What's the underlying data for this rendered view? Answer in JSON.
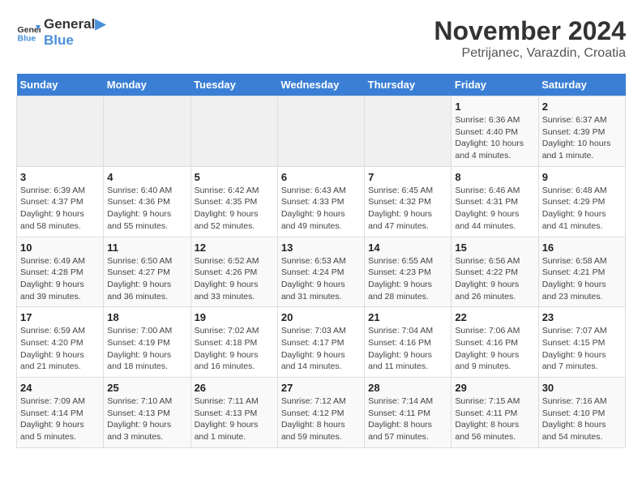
{
  "header": {
    "logo_general": "General",
    "logo_blue": "Blue",
    "month_title": "November 2024",
    "location": "Petrijanec, Varazdin, Croatia"
  },
  "days_of_week": [
    "Sunday",
    "Monday",
    "Tuesday",
    "Wednesday",
    "Thursday",
    "Friday",
    "Saturday"
  ],
  "weeks": [
    [
      {
        "day": "",
        "info": ""
      },
      {
        "day": "",
        "info": ""
      },
      {
        "day": "",
        "info": ""
      },
      {
        "day": "",
        "info": ""
      },
      {
        "day": "",
        "info": ""
      },
      {
        "day": "1",
        "info": "Sunrise: 6:36 AM\nSunset: 4:40 PM\nDaylight: 10 hours and 4 minutes."
      },
      {
        "day": "2",
        "info": "Sunrise: 6:37 AM\nSunset: 4:39 PM\nDaylight: 10 hours and 1 minute."
      }
    ],
    [
      {
        "day": "3",
        "info": "Sunrise: 6:39 AM\nSunset: 4:37 PM\nDaylight: 9 hours and 58 minutes."
      },
      {
        "day": "4",
        "info": "Sunrise: 6:40 AM\nSunset: 4:36 PM\nDaylight: 9 hours and 55 minutes."
      },
      {
        "day": "5",
        "info": "Sunrise: 6:42 AM\nSunset: 4:35 PM\nDaylight: 9 hours and 52 minutes."
      },
      {
        "day": "6",
        "info": "Sunrise: 6:43 AM\nSunset: 4:33 PM\nDaylight: 9 hours and 49 minutes."
      },
      {
        "day": "7",
        "info": "Sunrise: 6:45 AM\nSunset: 4:32 PM\nDaylight: 9 hours and 47 minutes."
      },
      {
        "day": "8",
        "info": "Sunrise: 6:46 AM\nSunset: 4:31 PM\nDaylight: 9 hours and 44 minutes."
      },
      {
        "day": "9",
        "info": "Sunrise: 6:48 AM\nSunset: 4:29 PM\nDaylight: 9 hours and 41 minutes."
      }
    ],
    [
      {
        "day": "10",
        "info": "Sunrise: 6:49 AM\nSunset: 4:28 PM\nDaylight: 9 hours and 39 minutes."
      },
      {
        "day": "11",
        "info": "Sunrise: 6:50 AM\nSunset: 4:27 PM\nDaylight: 9 hours and 36 minutes."
      },
      {
        "day": "12",
        "info": "Sunrise: 6:52 AM\nSunset: 4:26 PM\nDaylight: 9 hours and 33 minutes."
      },
      {
        "day": "13",
        "info": "Sunrise: 6:53 AM\nSunset: 4:24 PM\nDaylight: 9 hours and 31 minutes."
      },
      {
        "day": "14",
        "info": "Sunrise: 6:55 AM\nSunset: 4:23 PM\nDaylight: 9 hours and 28 minutes."
      },
      {
        "day": "15",
        "info": "Sunrise: 6:56 AM\nSunset: 4:22 PM\nDaylight: 9 hours and 26 minutes."
      },
      {
        "day": "16",
        "info": "Sunrise: 6:58 AM\nSunset: 4:21 PM\nDaylight: 9 hours and 23 minutes."
      }
    ],
    [
      {
        "day": "17",
        "info": "Sunrise: 6:59 AM\nSunset: 4:20 PM\nDaylight: 9 hours and 21 minutes."
      },
      {
        "day": "18",
        "info": "Sunrise: 7:00 AM\nSunset: 4:19 PM\nDaylight: 9 hours and 18 minutes."
      },
      {
        "day": "19",
        "info": "Sunrise: 7:02 AM\nSunset: 4:18 PM\nDaylight: 9 hours and 16 minutes."
      },
      {
        "day": "20",
        "info": "Sunrise: 7:03 AM\nSunset: 4:17 PM\nDaylight: 9 hours and 14 minutes."
      },
      {
        "day": "21",
        "info": "Sunrise: 7:04 AM\nSunset: 4:16 PM\nDaylight: 9 hours and 11 minutes."
      },
      {
        "day": "22",
        "info": "Sunrise: 7:06 AM\nSunset: 4:16 PM\nDaylight: 9 hours and 9 minutes."
      },
      {
        "day": "23",
        "info": "Sunrise: 7:07 AM\nSunset: 4:15 PM\nDaylight: 9 hours and 7 minutes."
      }
    ],
    [
      {
        "day": "24",
        "info": "Sunrise: 7:09 AM\nSunset: 4:14 PM\nDaylight: 9 hours and 5 minutes."
      },
      {
        "day": "25",
        "info": "Sunrise: 7:10 AM\nSunset: 4:13 PM\nDaylight: 9 hours and 3 minutes."
      },
      {
        "day": "26",
        "info": "Sunrise: 7:11 AM\nSunset: 4:13 PM\nDaylight: 9 hours and 1 minute."
      },
      {
        "day": "27",
        "info": "Sunrise: 7:12 AM\nSunset: 4:12 PM\nDaylight: 8 hours and 59 minutes."
      },
      {
        "day": "28",
        "info": "Sunrise: 7:14 AM\nSunset: 4:11 PM\nDaylight: 8 hours and 57 minutes."
      },
      {
        "day": "29",
        "info": "Sunrise: 7:15 AM\nSunset: 4:11 PM\nDaylight: 8 hours and 56 minutes."
      },
      {
        "day": "30",
        "info": "Sunrise: 7:16 AM\nSunset: 4:10 PM\nDaylight: 8 hours and 54 minutes."
      }
    ]
  ]
}
